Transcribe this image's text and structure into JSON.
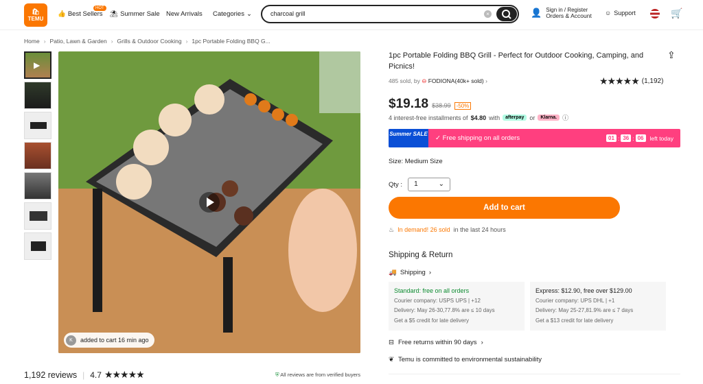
{
  "header": {
    "logo": "TEMU",
    "nav": [
      {
        "label": "Best Sellers",
        "badge": "HOT"
      },
      {
        "label": "Summer Sale"
      },
      {
        "label": "New Arrivals"
      },
      {
        "label": "Categories"
      }
    ],
    "search_value": "charcoal grill",
    "account_line1": "Sign in / Register",
    "account_line2": "Orders & Account",
    "support": "Support"
  },
  "breadcrumb": [
    "Home",
    "Patio, Lawn & Garden",
    "Grills & Outdoor Cooking",
    "1pc Portable Folding BBQ G..."
  ],
  "gallery": {
    "added_initial": "K",
    "added_text": "added to cart 16 min ago"
  },
  "reviews": {
    "count": "1,192 reviews",
    "score": "4.7",
    "stars": "★★★★★",
    "verified": "All reviews are from verified buyers"
  },
  "product": {
    "title": "1pc Portable Folding BBQ Grill - Perfect for Outdoor Cooking, Camping, and Picnics!",
    "sold": "485 sold, by",
    "seller": "FODIONA(40k+ sold)",
    "rating_count": "(1,192)",
    "price": "$19.18",
    "was": "$38.99",
    "off": "-50%",
    "install_text": "4 interest-free installments of",
    "install_amount": "$4.80",
    "install_with": "with",
    "afterpay": "afterpay",
    "or": "or",
    "klarna": "Klarna.",
    "sale_badge": "Summer SALE",
    "sale_text": "Free shipping on all orders",
    "timer": [
      "01",
      "36",
      "06"
    ],
    "timer_suffix": "left today",
    "size": "Size: Medium Size",
    "qty_label": "Qty :",
    "qty_value": "1",
    "add_to_cart": "Add to cart",
    "demand_hot": "In demand! 26 sold",
    "demand_rest": "in the last 24 hours"
  },
  "shipping": {
    "heading": "Shipping & Return",
    "link": "Shipping",
    "standard": {
      "title": "Standard: free on all orders",
      "courier": "Courier company:  USPS  UPS | +12",
      "delivery": "Delivery: May 26-30,77.8% are ≤ 10 days",
      "credit": "Get a $5 credit for late delivery"
    },
    "express": {
      "title": "Express: $12.90, free over $129.00",
      "courier": "Courier company:  UPS  DHL | +1",
      "delivery": "Delivery: May 25-27,81.9% are ≤ 7 days",
      "credit": "Get a $13 credit for late delivery"
    },
    "returns": "Free returns within 90 days",
    "env": "Temu is committed to environmental sustainability"
  },
  "colors": {
    "accent": "#fb7701",
    "sale_pink": "#ff3f7f",
    "sale_blue": "#0a4fd6"
  }
}
